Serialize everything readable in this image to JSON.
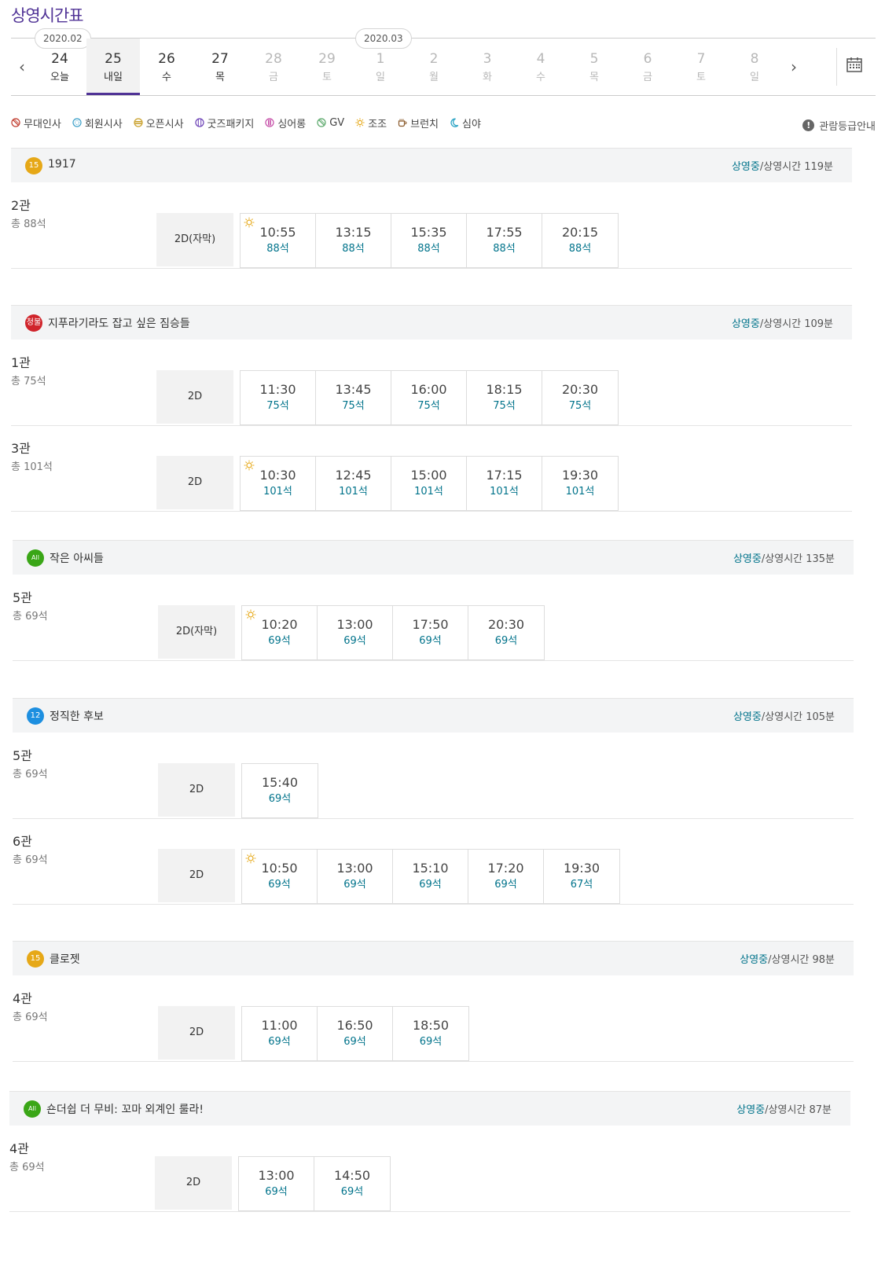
{
  "page_title": "상영시간표",
  "date_strip": {
    "months": [
      "2020.02",
      "2020.03"
    ],
    "dates": [
      {
        "day": "24",
        "weekday": "오늘",
        "disabled": false,
        "active": false
      },
      {
        "day": "25",
        "weekday": "내일",
        "disabled": false,
        "active": true
      },
      {
        "day": "26",
        "weekday": "수",
        "disabled": false,
        "active": false
      },
      {
        "day": "27",
        "weekday": "목",
        "disabled": false,
        "active": false
      },
      {
        "day": "28",
        "weekday": "금",
        "disabled": true,
        "active": false
      },
      {
        "day": "29",
        "weekday": "토",
        "disabled": true,
        "active": false
      },
      {
        "day": "1",
        "weekday": "일",
        "disabled": true,
        "active": false
      },
      {
        "day": "2",
        "weekday": "월",
        "disabled": true,
        "active": false
      },
      {
        "day": "3",
        "weekday": "화",
        "disabled": true,
        "active": false
      },
      {
        "day": "4",
        "weekday": "수",
        "disabled": true,
        "active": false
      },
      {
        "day": "5",
        "weekday": "목",
        "disabled": true,
        "active": false
      },
      {
        "day": "6",
        "weekday": "금",
        "disabled": true,
        "active": false
      },
      {
        "day": "7",
        "weekday": "토",
        "disabled": true,
        "active": false
      },
      {
        "day": "8",
        "weekday": "일",
        "disabled": true,
        "active": false
      }
    ],
    "prev_icon": "chevron-left-icon",
    "next_icon": "chevron-right-icon",
    "calendar_icon": "calendar-icon"
  },
  "legend": [
    {
      "label": "무대인사",
      "icon": "stage-greeting-icon",
      "color": "#c0392b"
    },
    {
      "label": "회원시사",
      "icon": "member-preview-icon",
      "color": "#3a9fc8"
    },
    {
      "label": "오픈시사",
      "icon": "open-preview-icon",
      "color": "#c9a02b"
    },
    {
      "label": "굿즈패키지",
      "icon": "goods-package-icon",
      "color": "#6a3fb5"
    },
    {
      "label": "싱어롱",
      "icon": "singalong-icon",
      "color": "#c44ba6"
    },
    {
      "label": "GV",
      "icon": "gv-icon",
      "color": "#5aa86a"
    },
    {
      "label": "조조",
      "icon": "morning-sun-icon",
      "color": "#e6a817"
    },
    {
      "label": "브런치",
      "icon": "brunch-cup-icon",
      "color": "#8a5a2b"
    },
    {
      "label": "심야",
      "icon": "late-night-moon-icon",
      "color": "#2aa3c4"
    }
  ],
  "rating_guide": {
    "label": "관람등급안내",
    "icon": "info-icon"
  },
  "status_label": "상영중",
  "runtime_prefix": "/상영시간 ",
  "movies": [
    {
      "rating": "15",
      "rating_color": "#e6a817",
      "title": "1917",
      "runtime": "119분",
      "halls": [
        {
          "name": "2관",
          "seats": "총 88석",
          "format": "2D(자막)",
          "times": [
            {
              "time": "10:55",
              "seats": "88석",
              "morning": true
            },
            {
              "time": "13:15",
              "seats": "88석",
              "morning": false
            },
            {
              "time": "15:35",
              "seats": "88석",
              "morning": false
            },
            {
              "time": "17:55",
              "seats": "88석",
              "morning": false
            },
            {
              "time": "20:15",
              "seats": "88석",
              "morning": false
            }
          ]
        }
      ]
    },
    {
      "rating": "청불",
      "rating_color": "#d0242b",
      "title": "지푸라기라도 잡고 싶은 짐승들",
      "runtime": "109분",
      "halls": [
        {
          "name": "1관",
          "seats": "총 75석",
          "format": "2D",
          "times": [
            {
              "time": "11:30",
              "seats": "75석",
              "morning": false
            },
            {
              "time": "13:45",
              "seats": "75석",
              "morning": false
            },
            {
              "time": "16:00",
              "seats": "75석",
              "morning": false
            },
            {
              "time": "18:15",
              "seats": "75석",
              "morning": false
            },
            {
              "time": "20:30",
              "seats": "75석",
              "morning": false
            }
          ]
        },
        {
          "name": "3관",
          "seats": "총 101석",
          "format": "2D",
          "times": [
            {
              "time": "10:30",
              "seats": "101석",
              "morning": true
            },
            {
              "time": "12:45",
              "seats": "101석",
              "morning": false
            },
            {
              "time": "15:00",
              "seats": "101석",
              "morning": false
            },
            {
              "time": "17:15",
              "seats": "101석",
              "morning": false
            },
            {
              "time": "19:30",
              "seats": "101석",
              "morning": false
            }
          ]
        }
      ]
    },
    {
      "rating": "All",
      "rating_color": "#3aa617",
      "title": "작은 아씨들",
      "runtime": "135분",
      "halls": [
        {
          "name": "5관",
          "seats": "총 69석",
          "format": "2D(자막)",
          "times": [
            {
              "time": "10:20",
              "seats": "69석",
              "morning": true
            },
            {
              "time": "13:00",
              "seats": "69석",
              "morning": false
            },
            {
              "time": "17:50",
              "seats": "69석",
              "morning": false
            },
            {
              "time": "20:30",
              "seats": "69석",
              "morning": false
            }
          ]
        }
      ]
    },
    {
      "rating": "12",
      "rating_color": "#1d8fe0",
      "title": "정직한 후보",
      "runtime": "105분",
      "halls": [
        {
          "name": "5관",
          "seats": "총 69석",
          "format": "2D",
          "times": [
            {
              "time": "15:40",
              "seats": "69석",
              "morning": false
            }
          ]
        },
        {
          "name": "6관",
          "seats": "총 69석",
          "format": "2D",
          "times": [
            {
              "time": "10:50",
              "seats": "69석",
              "morning": true
            },
            {
              "time": "13:00",
              "seats": "69석",
              "morning": false
            },
            {
              "time": "15:10",
              "seats": "69석",
              "morning": false
            },
            {
              "time": "17:20",
              "seats": "69석",
              "morning": false
            },
            {
              "time": "19:30",
              "seats": "67석",
              "morning": false
            }
          ]
        }
      ]
    },
    {
      "rating": "15",
      "rating_color": "#e6a817",
      "title": "클로젯",
      "runtime": "98분",
      "halls": [
        {
          "name": "4관",
          "seats": "총 69석",
          "format": "2D",
          "times": [
            {
              "time": "11:00",
              "seats": "69석",
              "morning": false
            },
            {
              "time": "16:50",
              "seats": "69석",
              "morning": false
            },
            {
              "time": "18:50",
              "seats": "69석",
              "morning": false
            }
          ]
        }
      ]
    },
    {
      "rating": "All",
      "rating_color": "#3aa617",
      "title": "숀더쉽 더 무비: 꼬마 외계인 룰라!",
      "runtime": "87분",
      "halls": [
        {
          "name": "4관",
          "seats": "총 69석",
          "format": "2D",
          "times": [
            {
              "time": "13:00",
              "seats": "69석",
              "morning": false
            },
            {
              "time": "14:50",
              "seats": "69석",
              "morning": false
            }
          ]
        }
      ]
    }
  ]
}
